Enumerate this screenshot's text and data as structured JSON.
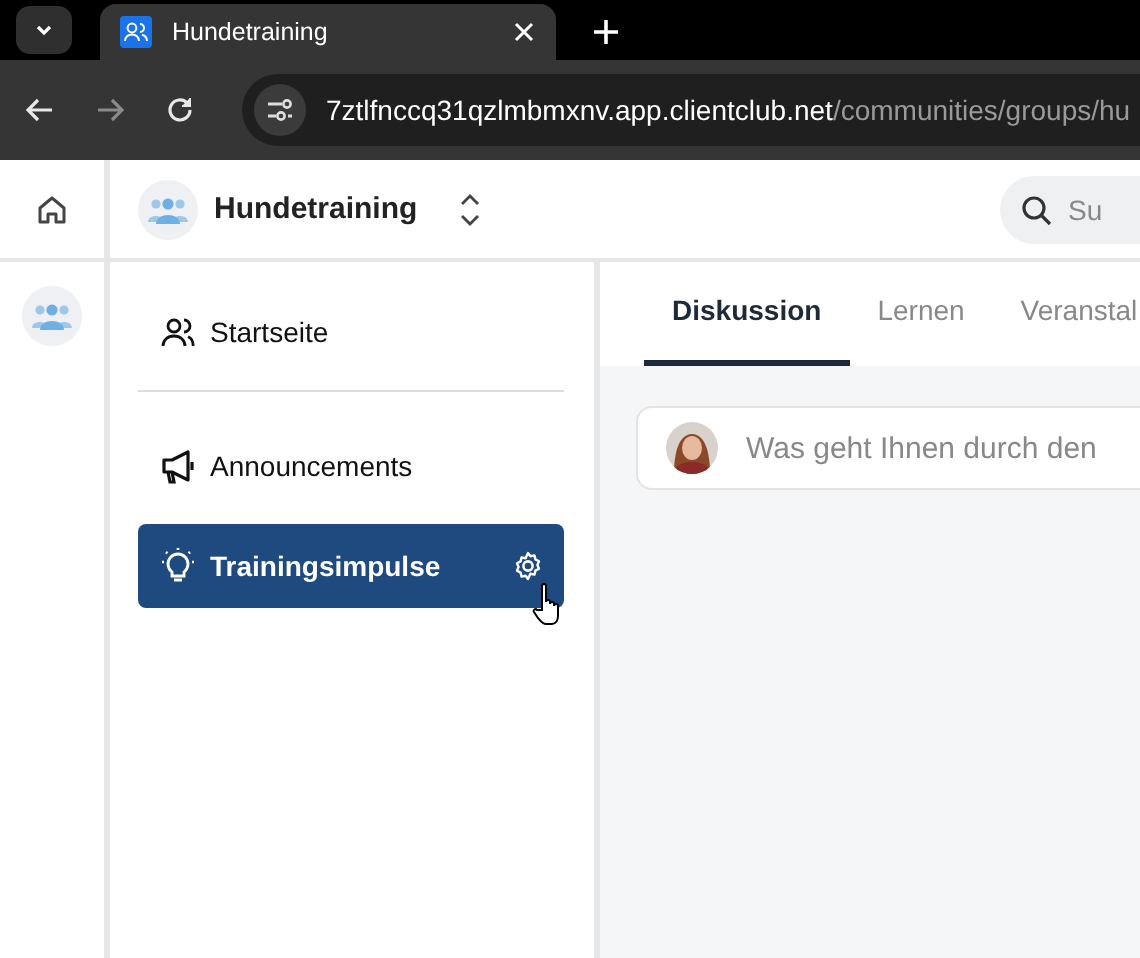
{
  "browser": {
    "tab": {
      "title": "Hundetraining"
    },
    "url": {
      "host": "7ztlfnccq31qzlmbmxnv.app.clientclub.net",
      "path": "/communities/groups/hu"
    }
  },
  "header": {
    "group": "Hundetraining",
    "search": {
      "placeholder": "Su"
    }
  },
  "sidebar": {
    "items": [
      {
        "label": "Startseite",
        "selected": false
      },
      {
        "label": "Announcements",
        "selected": false
      },
      {
        "label": "Trainingsimpulse",
        "selected": true
      }
    ]
  },
  "tabs": [
    {
      "label": "Diskussion",
      "selected": true
    },
    {
      "label": "Lernen",
      "selected": false
    },
    {
      "label": "Veranstal",
      "selected": false
    }
  ],
  "composer": {
    "placeholder": "Was geht Ihnen durch den"
  }
}
